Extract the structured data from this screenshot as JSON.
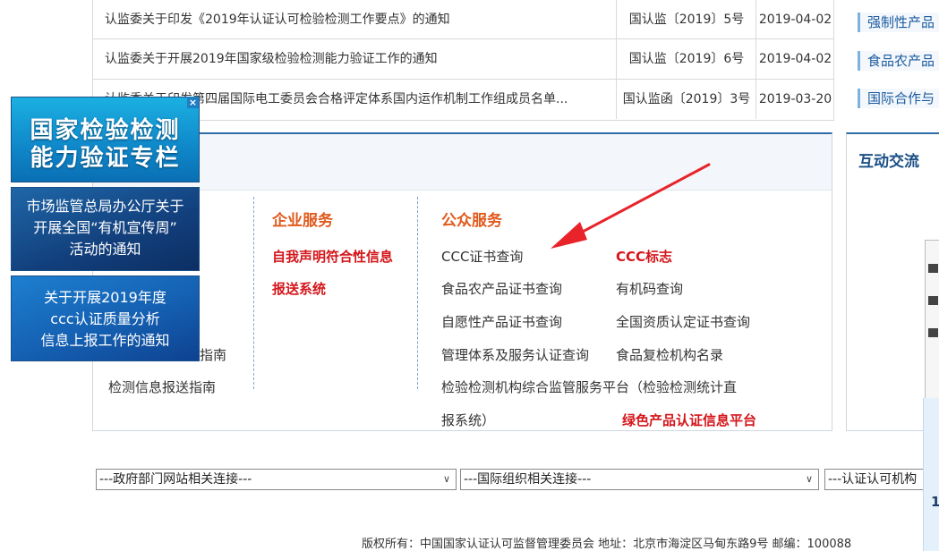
{
  "notices": [
    {
      "title": "认监委关于印发《2019年认证认可检验检测工作要点》的通知",
      "doc_no": "国认监〔2019〕5号",
      "date": "2019-04-02"
    },
    {
      "title": "认监委关于开展2019年国家级检验检测能力验证工作的通知",
      "doc_no": "国认监〔2019〕6号",
      "date": "2019-04-02"
    },
    {
      "title": "认监委关于印发第四届国际电工委员会合格评定体系国内运作机制工作组成员名单...",
      "doc_no": "国认监函〔2019〕3号",
      "date": "2019-03-20"
    }
  ],
  "right_categories": [
    "强制性产品",
    "食品农产品",
    "国际合作与"
  ],
  "ads": {
    "ad1": [
      "国家检验检测",
      "能力验证专栏"
    ],
    "ad2": [
      "市场监管总局办公厅关于",
      "开展全国“有机宣传周”",
      "活动的通知"
    ],
    "ad3": [
      "关于开展2019年度",
      "ccc认证质量分析",
      "信息上报工作的通知"
    ],
    "close": "×"
  },
  "left_column": {
    "partial_link": "指南",
    "link2": "检测信息报送指南"
  },
  "enterprise": {
    "title": "企业服务",
    "link_line1": "自我声明符合性信息",
    "link_line2": "报送系统"
  },
  "public": {
    "title": "公众服务",
    "links": [
      "CCC证书查询",
      "食品农产品证书查询",
      "自愿性产品证书查询",
      "管理体系及服务认证查询"
    ],
    "links_right": [
      "有机码查询",
      "全国资质认定证书查询",
      "食品复检机构名录"
    ],
    "red_links": [
      "CCC标志",
      "绿色产品认证信息平台"
    ],
    "platform_line1": "检验检测机构综合监管服务平台（检验检测统计直",
    "platform_line2": "报系统）"
  },
  "interaction": {
    "title": "互动交流"
  },
  "selects": [
    "---政府部门网站相关连接---",
    "---国际组织相关连接---",
    "---认证认可机构"
  ],
  "edge_number": "1",
  "footer": "版权所有：中国国家认证认可监督管理委员会  地址：北京市海淀区马甸东路9号  邮编：100088",
  "colors": {
    "accent_blue": "#2e6ca8",
    "orange_title": "#e05a1e",
    "red_link": "#d4161b",
    "arrow_red": "#e8232a"
  }
}
